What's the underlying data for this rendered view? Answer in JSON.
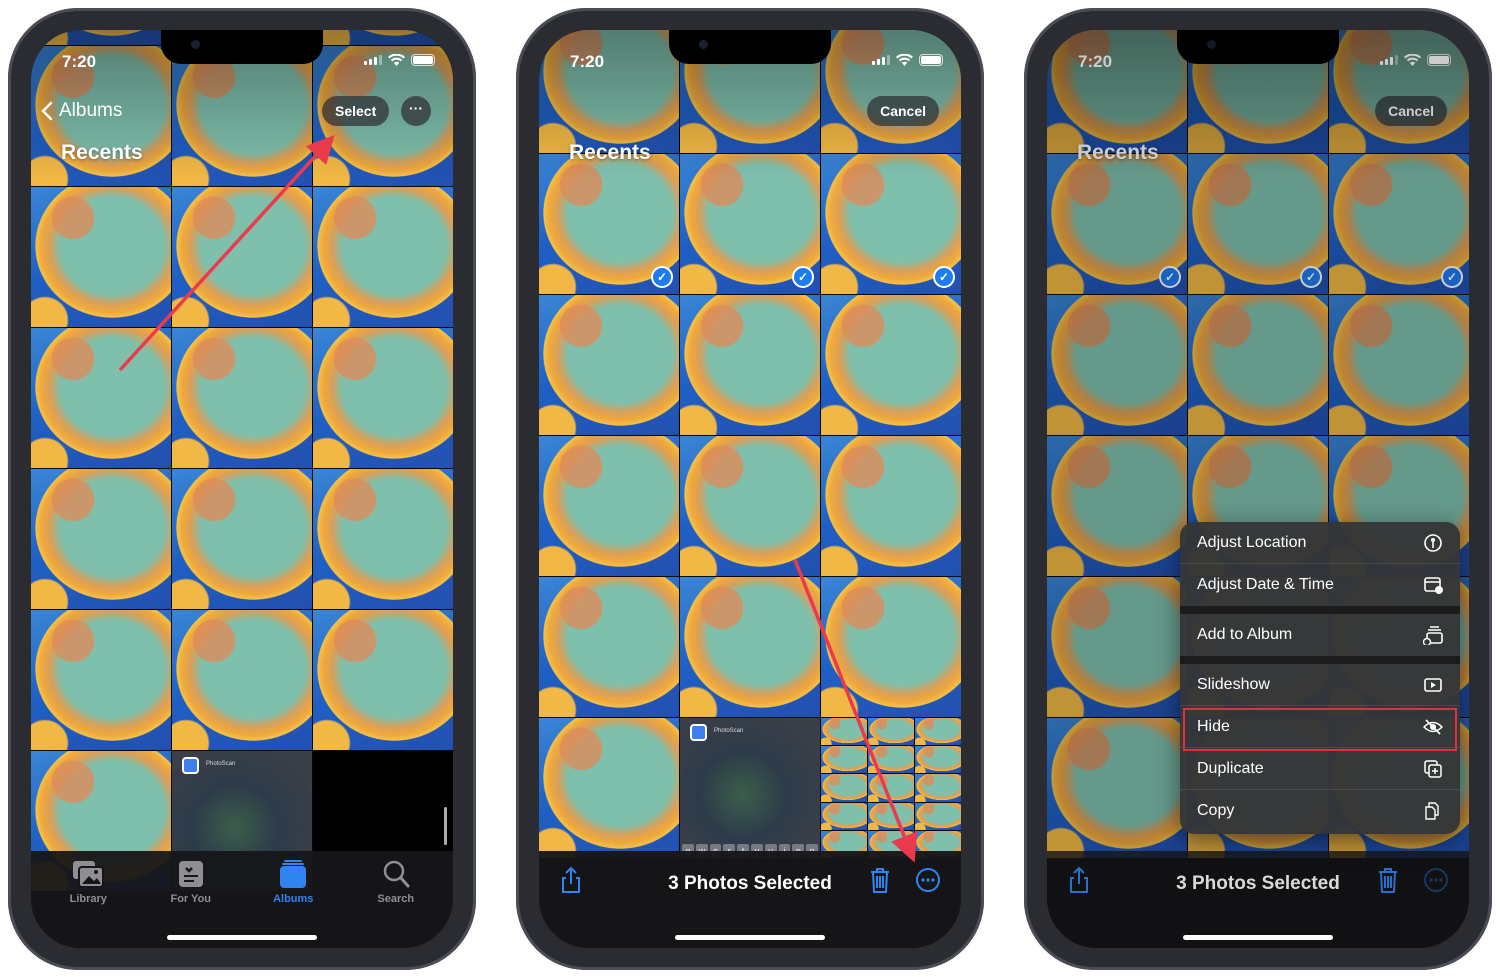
{
  "status": {
    "time": "7:20"
  },
  "colors": {
    "accent": "#2f84f0",
    "arrow": "#ec3a4d",
    "highlight": "#e03040"
  },
  "phone1": {
    "back_label": "Albums",
    "select_label": "Select",
    "more_label": "···",
    "title": "Recents",
    "photoscan_label": "PhotoScan",
    "tabs": [
      {
        "label": "Library",
        "icon": "photos-stack-icon"
      },
      {
        "label": "For You",
        "icon": "for-you-icon"
      },
      {
        "label": "Albums",
        "icon": "albums-icon",
        "active": true
      },
      {
        "label": "Search",
        "icon": "search-icon"
      }
    ]
  },
  "phone2": {
    "cancel_label": "Cancel",
    "title": "Recents",
    "photoscan_label": "PhotoScan",
    "keyboard_keys": [
      "q",
      "w",
      "e",
      "r",
      "t",
      "y",
      "u",
      "i",
      "o",
      "p"
    ],
    "selection_text": "3 Photos Selected",
    "selected_count": 3
  },
  "phone3": {
    "cancel_label": "Cancel",
    "title": "Recents",
    "selection_text": "3 Photos Selected",
    "menu": [
      {
        "label": "Adjust Location",
        "icon": "location-info-icon"
      },
      {
        "label": "Adjust Date & Time",
        "icon": "calendar-clock-icon"
      },
      {
        "label": "Add to Album",
        "icon": "add-to-album-icon"
      },
      {
        "label": "Slideshow",
        "icon": "play-icon"
      },
      {
        "label": "Hide",
        "icon": "eye-slash-icon",
        "highlighted": true
      },
      {
        "label": "Duplicate",
        "icon": "duplicate-icon"
      },
      {
        "label": "Copy",
        "icon": "copy-icon"
      }
    ]
  }
}
